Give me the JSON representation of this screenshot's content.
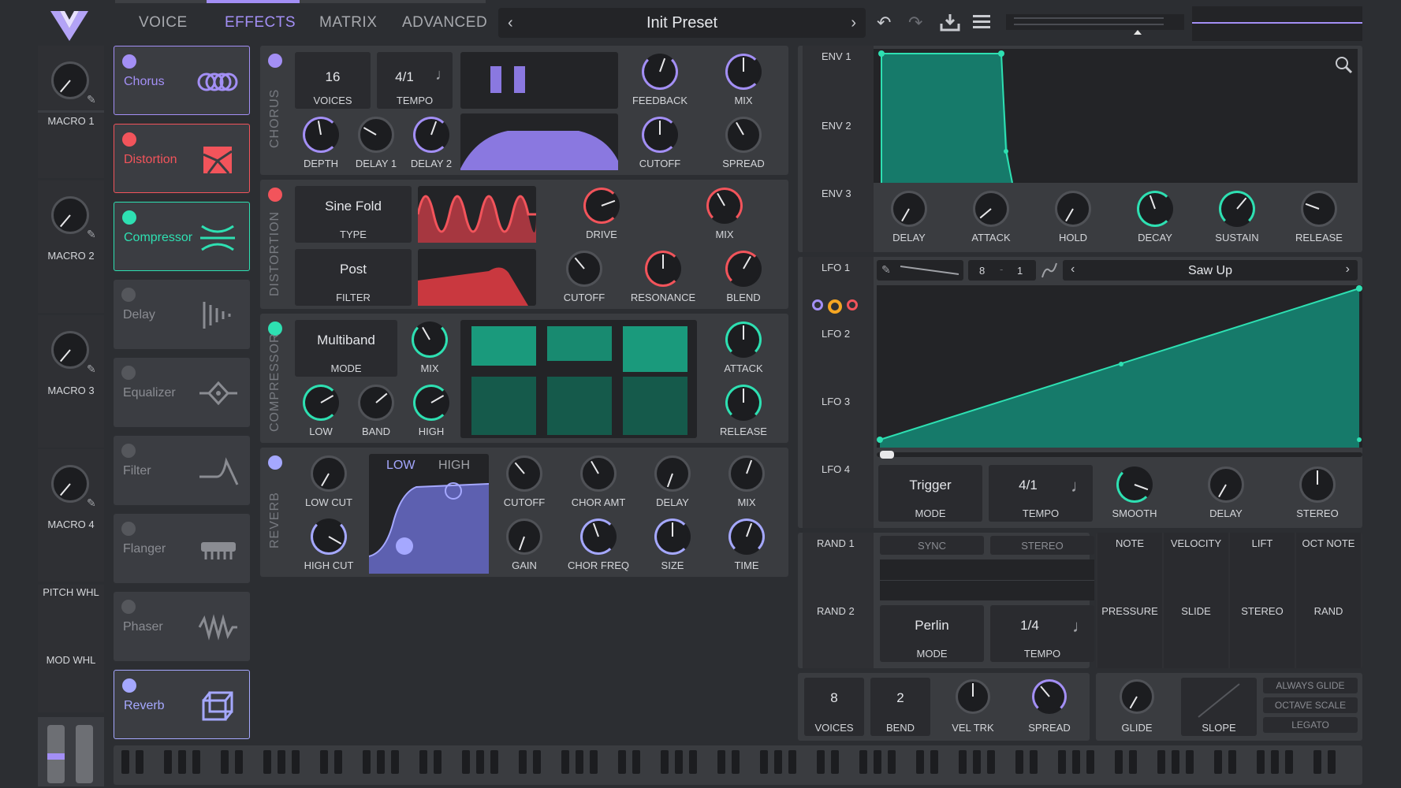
{
  "header": {
    "tabs": [
      {
        "label": "VOICE"
      },
      {
        "label": "EFFECTS"
      },
      {
        "label": "MATRIX"
      },
      {
        "label": "ADVANCED"
      }
    ],
    "active_tab": "EFFECTS",
    "preset_name": "Init Preset"
  },
  "macros": [
    {
      "label": "MACRO 1"
    },
    {
      "label": "MACRO 2"
    },
    {
      "label": "MACRO 3"
    },
    {
      "label": "MACRO 4"
    }
  ],
  "wheels": {
    "pitch": "PITCH WHL",
    "mod": "MOD WHL"
  },
  "effects_list": [
    {
      "name": "Chorus",
      "color": "#a38ff5",
      "active": true
    },
    {
      "name": "Distortion",
      "color": "#f2545b",
      "active": true
    },
    {
      "name": "Compressor",
      "color": "#2ee0b2",
      "active": true
    },
    {
      "name": "Delay",
      "color": "#8a8c92",
      "active": false
    },
    {
      "name": "Equalizer",
      "color": "#8a8c92",
      "active": false
    },
    {
      "name": "Filter",
      "color": "#8a8c92",
      "active": false
    },
    {
      "name": "Flanger",
      "color": "#8a8c92",
      "active": false
    },
    {
      "name": "Phaser",
      "color": "#8a8c92",
      "active": false
    },
    {
      "name": "Reverb",
      "color": "#a5a8ff",
      "active": true
    }
  ],
  "chorus": {
    "title": "CHORUS",
    "voices_value": "16",
    "voices_label": "VOICES",
    "tempo_value": "4/1",
    "tempo_label": "TEMPO",
    "knobs": {
      "feedback": "FEEDBACK",
      "mix": "MIX",
      "depth": "DEPTH",
      "delay1": "DELAY 1",
      "delay2": "DELAY 2",
      "cutoff": "CUTOFF",
      "spread": "SPREAD"
    }
  },
  "distortion": {
    "title": "DISTORTION",
    "type_value": "Sine Fold",
    "type_label": "TYPE",
    "filter_value": "Post",
    "filter_label": "FILTER",
    "knobs": {
      "drive": "DRIVE",
      "mix": "MIX",
      "cutoff": "CUTOFF",
      "resonance": "RESONANCE",
      "blend": "BLEND"
    }
  },
  "compressor": {
    "title": "COMPRESSOR",
    "mode_value": "Multiband",
    "mode_label": "MODE",
    "knobs": {
      "mix": "MIX",
      "attack": "ATTACK",
      "low": "LOW",
      "band": "BAND",
      "high": "HIGH",
      "release": "RELEASE"
    }
  },
  "reverb": {
    "title": "REVERB",
    "low_tab": "LOW",
    "high_tab": "HIGH",
    "knobs": {
      "low_cut": "LOW CUT",
      "high_cut": "HIGH CUT",
      "cutoff": "CUTOFF",
      "chor_amt": "CHOR AMT",
      "delay": "DELAY",
      "mix": "MIX",
      "gain": "GAIN",
      "chor_freq": "CHOR FREQ",
      "size": "SIZE",
      "time": "TIME"
    }
  },
  "envelopes": {
    "labels": [
      "ENV 1",
      "ENV 2",
      "ENV 3"
    ],
    "knobs": [
      "DELAY",
      "ATTACK",
      "HOLD",
      "DECAY",
      "SUSTAIN",
      "RELEASE"
    ]
  },
  "lfos": {
    "labels": [
      "LFO 1",
      "LFO 2",
      "LFO 3",
      "LFO 4"
    ],
    "rate_left": "8",
    "rate_right": "1",
    "shape_name": "Saw Up",
    "mode_value": "Trigger",
    "mode_label": "MODE",
    "tempo_value": "4/1",
    "tempo_label": "TEMPO",
    "knobs": [
      "SMOOTH",
      "DELAY",
      "STEREO"
    ]
  },
  "random": {
    "labels": [
      "RAND 1",
      "RAND 2"
    ],
    "sync": "SYNC",
    "stereo": "STEREO",
    "mode_value": "Perlin",
    "mode_label": "MODE",
    "tempo_value": "1/4",
    "tempo_label": "TEMPO"
  },
  "mod_sources": {
    "row1": [
      "NOTE",
      "VELOCITY",
      "LIFT",
      "OCT NOTE"
    ],
    "row2": [
      "PRESSURE",
      "SLIDE",
      "STEREO",
      "RAND"
    ]
  },
  "voice": {
    "voices_value": "8",
    "voices_label": "VOICES",
    "bend_value": "2",
    "bend_label": "BEND",
    "vel_trk": "VEL TRK",
    "spread": "SPREAD",
    "glide": "GLIDE",
    "slope": "SLOPE",
    "always_glide": "ALWAYS GLIDE",
    "octave_scale": "OCTAVE SCALE",
    "legato": "LEGATO"
  },
  "colors": {
    "accent": "#a38ff5",
    "distortion": "#f2545b",
    "compressor": "#2ee0b2",
    "reverb": "#a5a8ff",
    "teal": "#19c7aa"
  }
}
